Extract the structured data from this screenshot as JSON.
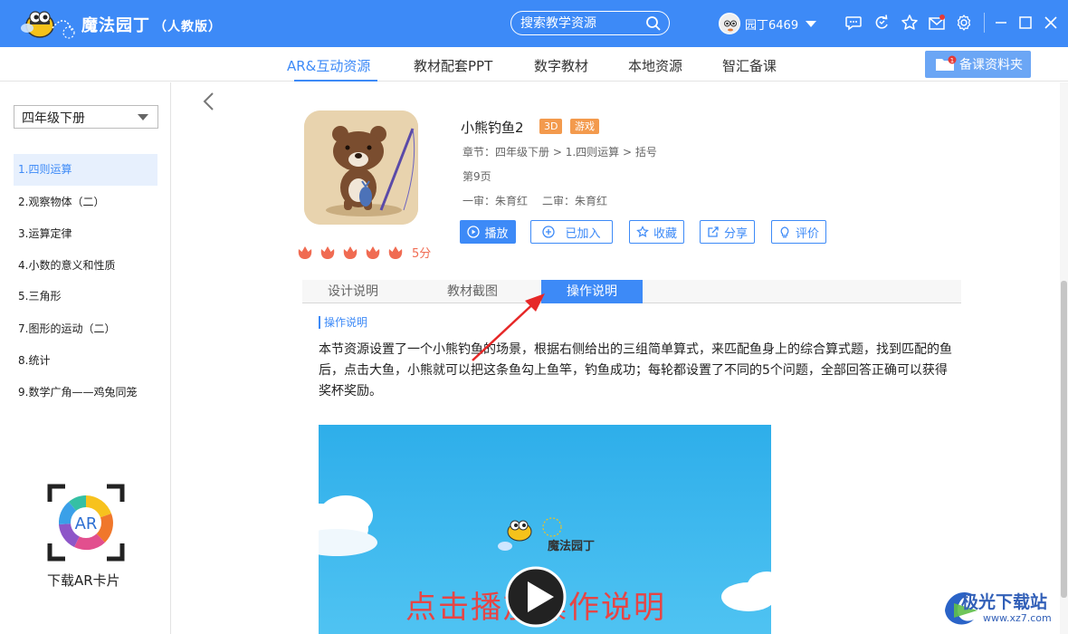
{
  "app": {
    "title": "魔法园丁",
    "edition": "（人教版）",
    "accent": "#3d8af7"
  },
  "search": {
    "placeholder": "搜索教学资源"
  },
  "user": {
    "name": "园丁6469"
  },
  "titlebar_icons": [
    "chat-icon",
    "refresh-icon",
    "star-icon",
    "mail-icon",
    "settings-icon",
    "minimize-icon",
    "maximize-icon",
    "close-icon"
  ],
  "nav": {
    "tabs": [
      "AR&互动资源",
      "教材配套PPT",
      "数字教材",
      "本地资源",
      "智汇备课"
    ],
    "active": 0,
    "folder_label": "备课资料夹",
    "folder_count": "1"
  },
  "sidebar": {
    "grade": "四年级下册",
    "chapters": [
      "1.四则运算",
      "2.观察物体（二）",
      "3.运算定律",
      "4.小数的意义和性质",
      "5.三角形",
      "7.图形的运动（二）",
      "8.统计",
      "9.数学广角——鸡兔同笼"
    ],
    "active": 0,
    "ar_label": "下载AR卡片"
  },
  "resource": {
    "title": "小熊钓鱼2",
    "badges": [
      "3D",
      "游戏"
    ],
    "chapter_label": "章节：",
    "chapter_path": "四年级下册 > 1.四则运算 > 括号",
    "page": "第9页",
    "review1": "一审：朱育红",
    "review2": "二审：朱育红",
    "rating": 5,
    "score_label": "5分",
    "buttons": {
      "play": "播放",
      "added": "已加入",
      "favorite": "收藏",
      "share": "分享",
      "review": "评价"
    }
  },
  "tabs": [
    "设计说明",
    "教材截图",
    "操作说明"
  ],
  "active_tab": 2,
  "section": {
    "label": "操作说明",
    "text": "本节资源设置了一个小熊钓鱼的场景，根据右侧给出的三组简单算式，来匹配鱼身上的综合算式题，找到匹配的鱼后，点击大鱼，小熊就可以把这条鱼勾上鱼竿，钓鱼成功；每轮都设置了不同的5个问题，全部回答正确可以获得奖杯奖励。"
  },
  "video": {
    "logo_text": "魔法园丁",
    "caption": "点击播放操作说明"
  },
  "watermark": {
    "name": "极光下载站",
    "url": "www.xz7.com"
  }
}
